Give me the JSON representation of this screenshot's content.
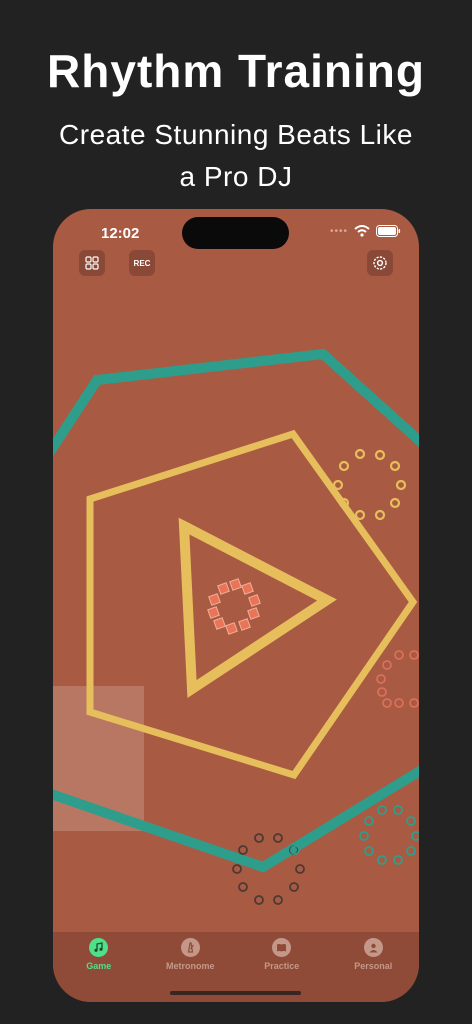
{
  "promo": {
    "title": "Rhythm Training",
    "subtitle_line1": "Create Stunning Beats Like",
    "subtitle_line2": "a Pro DJ"
  },
  "status_bar": {
    "time": "12:02"
  },
  "toolbar": {
    "grid_icon": "grid-icon",
    "rec_label": "REC",
    "settings_icon": "settings-icon"
  },
  "colors": {
    "background": "#222222",
    "game_bg": "#a85a42",
    "tabbar_bg": "#8f4b38",
    "teal": "#2f9d8c",
    "yellow": "#e7be5c",
    "coral": "#e97458",
    "active_tab": "#4fe08a",
    "inactive_tab": "#c49888"
  },
  "tabs": [
    {
      "label": "Game",
      "icon": "music-note-icon",
      "active": true
    },
    {
      "label": "Metronome",
      "icon": "metronome-icon",
      "active": false
    },
    {
      "label": "Practice",
      "icon": "book-icon",
      "active": false
    },
    {
      "label": "Personal",
      "icon": "person-icon",
      "active": false
    }
  ]
}
